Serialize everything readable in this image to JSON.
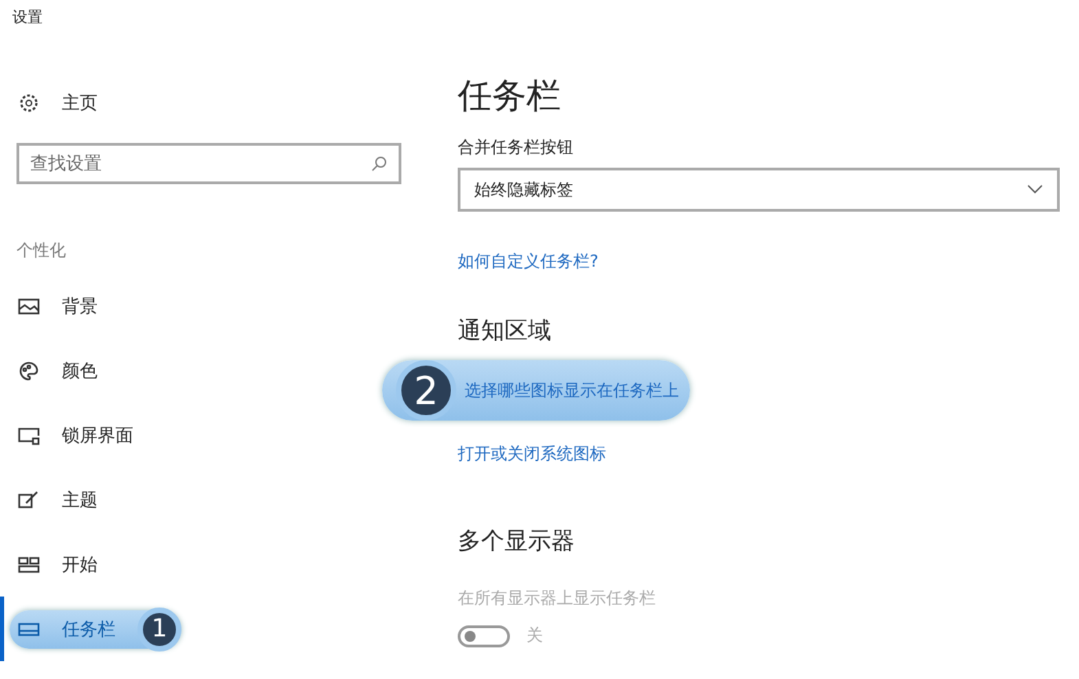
{
  "window": {
    "title": "设置"
  },
  "sidebar": {
    "home": {
      "label": "主页"
    },
    "search": {
      "placeholder": "查找设置"
    },
    "section": "个性化",
    "items": [
      {
        "label": "背景",
        "selected": false,
        "highlighted": false
      },
      {
        "label": "颜色",
        "selected": false,
        "highlighted": false
      },
      {
        "label": "锁屏界面",
        "selected": false,
        "highlighted": false
      },
      {
        "label": "主题",
        "selected": false,
        "highlighted": false
      },
      {
        "label": "开始",
        "selected": false,
        "highlighted": false
      },
      {
        "label": "任务栏",
        "selected": true,
        "highlighted": true,
        "callout": "1"
      }
    ]
  },
  "content": {
    "title": "任务栏",
    "combine": {
      "label": "合并任务栏按钮",
      "value": "始终隐藏标签"
    },
    "help_link": "如何自定义任务栏?",
    "notification": {
      "heading": "通知区域",
      "links": [
        {
          "label": "选择哪些图标显示在任务栏上",
          "highlighted": true,
          "callout": "2"
        },
        {
          "label": "打开或关闭系统图标",
          "highlighted": false
        }
      ]
    },
    "multi": {
      "heading": "多个显示器",
      "setting": {
        "label": "在所有显示器上显示任务栏",
        "on": false,
        "disabled": true,
        "state": "关"
      }
    }
  }
}
